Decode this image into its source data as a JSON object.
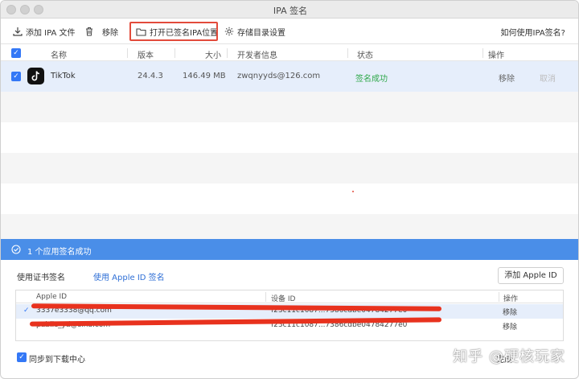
{
  "window": {
    "title": "IPA 签名"
  },
  "toolbar": {
    "add_label": "添加 IPA 文件",
    "remove_label": "移除",
    "open_signed_label": "打开已签名IPA位置",
    "storage_label": "存储目录设置",
    "help_label": "如何使用IPA签名?"
  },
  "table": {
    "headers": [
      "名称",
      "版本",
      "大小",
      "开发者信息",
      "状态",
      "操作"
    ],
    "rows": [
      {
        "name": "TikTok",
        "version": "24.4.3",
        "size": "146.49 MB",
        "developer": "zwqnyyds@126.com",
        "status": "签名成功",
        "remove": "移除",
        "cancel": "取消"
      }
    ]
  },
  "banner": {
    "text": "1 个应用签名成功"
  },
  "signing_tabs": {
    "cert_label": "使用证书签名",
    "appleid_label": "使用 Apple ID 签名",
    "add_appleid_label": "添加 Apple ID"
  },
  "appleid_table": {
    "headers": [
      "Apple ID",
      "设备 ID",
      "操作"
    ],
    "rows": [
      {
        "apple_id": "3337e3338@qq.com",
        "device_id": "f23c11c1087...7386cdbe04784277e0",
        "action": "移除",
        "selected": true
      },
      {
        "apple_id": "public_yd@sina.com",
        "device_id": "f23c11c1087...7386cdbe04784277e0",
        "action": "移除",
        "selected": false
      }
    ]
  },
  "footer": {
    "sync_label": "同步到下载中心",
    "close_label": "完成"
  },
  "watermark": {
    "text": "知乎 @硬核玩家"
  },
  "colors": {
    "accent": "#3478f6",
    "banner": "#4a8ee8",
    "success": "#2ea84a",
    "highlight": "#e24b3b"
  }
}
